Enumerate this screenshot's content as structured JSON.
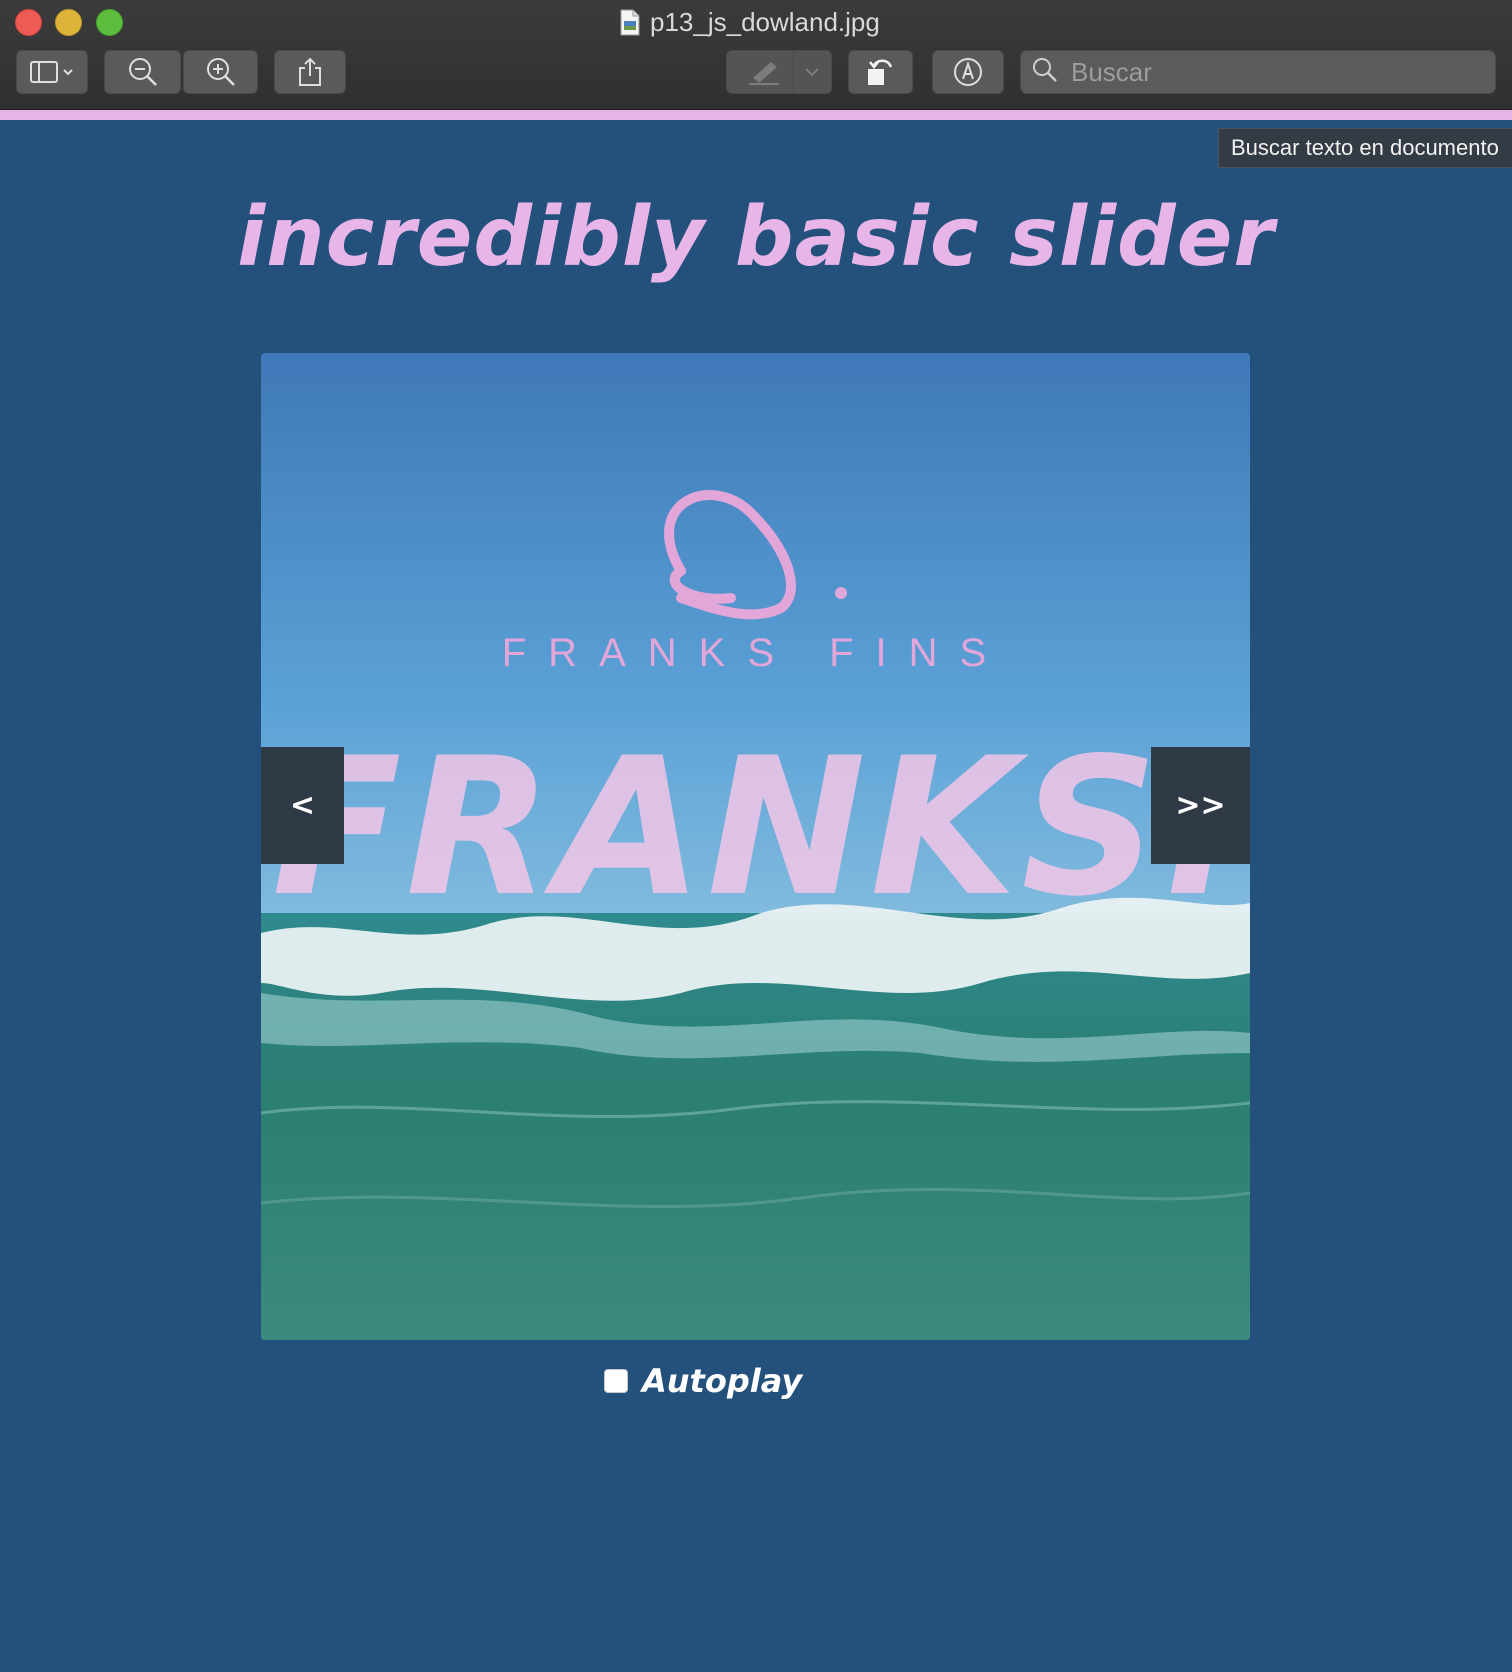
{
  "window": {
    "title": "p13_js_dowland.jpg"
  },
  "toolbar": {
    "sidebar_icon": "sidebar-icon",
    "zoom_out_icon": "zoom-out-icon",
    "zoom_in_icon": "zoom-in-icon",
    "share_icon": "share-icon",
    "markup_icon": "pen-icon",
    "rotate_icon": "rotate-icon",
    "annotate_icon": "annotate-icon",
    "search_placeholder": "Buscar"
  },
  "tooltip": {
    "text": "Buscar texto en documento"
  },
  "page": {
    "heading": "incredibly basic slider",
    "slide": {
      "brand_name": "FRANKS FINS",
      "big_text": "FRANKS."
    },
    "prev_label": "<",
    "next_label": ">>",
    "autoplay_label": "Autoplay",
    "autoplay_checked": false
  },
  "colors": {
    "page_bg": "#23517b",
    "accent_pink": "#e7b5e8",
    "nav_bg": "#2f3a46"
  }
}
